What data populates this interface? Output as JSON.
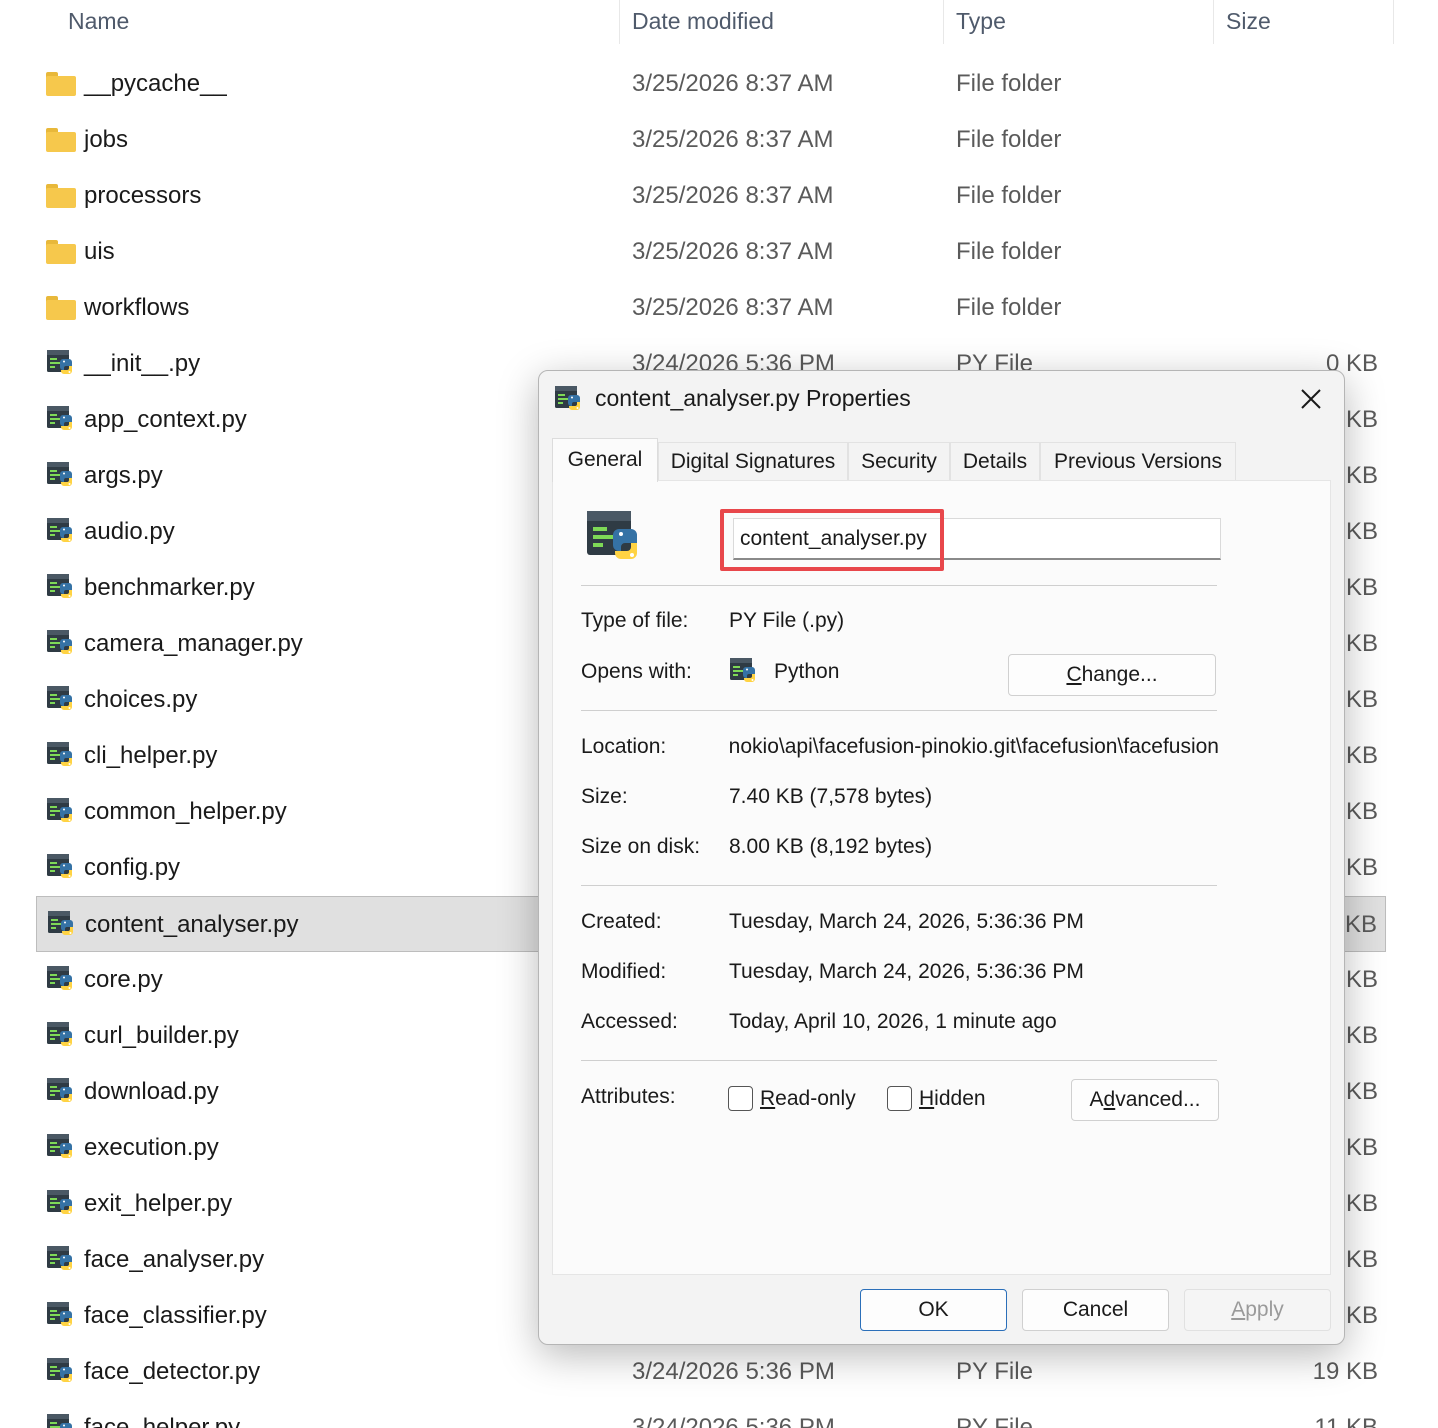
{
  "explorer": {
    "columns": {
      "name": "Name",
      "date": "Date modified",
      "type": "Type",
      "size": "Size"
    },
    "rows": [
      {
        "name": "__pycache__",
        "date": "3/25/2026 8:37 AM",
        "type": "File folder",
        "size": "",
        "icon": "folder-icon"
      },
      {
        "name": "jobs",
        "date": "3/25/2026 8:37 AM",
        "type": "File folder",
        "size": "",
        "icon": "folder-icon"
      },
      {
        "name": "processors",
        "date": "3/25/2026 8:37 AM",
        "type": "File folder",
        "size": "",
        "icon": "folder-icon"
      },
      {
        "name": "uis",
        "date": "3/25/2026 8:37 AM",
        "type": "File folder",
        "size": "",
        "icon": "folder-icon"
      },
      {
        "name": "workflows",
        "date": "3/25/2026 8:37 AM",
        "type": "File folder",
        "size": "",
        "icon": "folder-icon"
      },
      {
        "name": "__init__.py",
        "date": "3/24/2026 5:36 PM",
        "type": "PY File",
        "size": "0 KB",
        "icon": "python-file-icon"
      },
      {
        "name": "app_context.py",
        "date": "",
        "type": "",
        "size": "KB",
        "icon": "python-file-icon"
      },
      {
        "name": "args.py",
        "date": "",
        "type": "",
        "size": "KB",
        "icon": "python-file-icon"
      },
      {
        "name": "audio.py",
        "date": "",
        "type": "",
        "size": "KB",
        "icon": "python-file-icon"
      },
      {
        "name": "benchmarker.py",
        "date": "",
        "type": "",
        "size": "KB",
        "icon": "python-file-icon"
      },
      {
        "name": "camera_manager.py",
        "date": "",
        "type": "",
        "size": "KB",
        "icon": "python-file-icon"
      },
      {
        "name": "choices.py",
        "date": "",
        "type": "",
        "size": "KB",
        "icon": "python-file-icon"
      },
      {
        "name": "cli_helper.py",
        "date": "",
        "type": "",
        "size": "KB",
        "icon": "python-file-icon"
      },
      {
        "name": "common_helper.py",
        "date": "",
        "type": "",
        "size": "KB",
        "icon": "python-file-icon"
      },
      {
        "name": "config.py",
        "date": "",
        "type": "",
        "size": "KB",
        "icon": "python-file-icon"
      },
      {
        "name": "content_analyser.py",
        "date": "",
        "type": "",
        "size": "KB",
        "icon": "python-file-icon",
        "selected": true
      },
      {
        "name": "core.py",
        "date": "",
        "type": "",
        "size": "KB",
        "icon": "python-file-icon"
      },
      {
        "name": "curl_builder.py",
        "date": "",
        "type": "",
        "size": "KB",
        "icon": "python-file-icon"
      },
      {
        "name": "download.py",
        "date": "",
        "type": "",
        "size": "KB",
        "icon": "python-file-icon"
      },
      {
        "name": "execution.py",
        "date": "",
        "type": "",
        "size": "KB",
        "icon": "python-file-icon"
      },
      {
        "name": "exit_helper.py",
        "date": "",
        "type": "",
        "size": "KB",
        "icon": "python-file-icon"
      },
      {
        "name": "face_analyser.py",
        "date": "",
        "type": "",
        "size": "KB",
        "icon": "python-file-icon"
      },
      {
        "name": "face_classifier.py",
        "date": "",
        "type": "",
        "size": "KB",
        "icon": "python-file-icon"
      },
      {
        "name": "face_detector.py",
        "date": "3/24/2026 5:36 PM",
        "type": "PY File",
        "size": "19 KB",
        "icon": "python-file-icon"
      },
      {
        "name": "face_helper.py",
        "date": "3/24/2026 5:36 PM",
        "type": "PY File",
        "size": "11 KB",
        "icon": "python-file-icon"
      }
    ]
  },
  "dialog": {
    "title": "content_analyser.py Properties",
    "tabs": [
      "General",
      "Digital Signatures",
      "Security",
      "Details",
      "Previous Versions"
    ],
    "active_tab": "General",
    "filename": "content_analyser.py",
    "type_label": "Type of file:",
    "type_value": "PY File (.py)",
    "opens_label": "Opens with:",
    "opens_value": "Python",
    "change_button": {
      "pre": "",
      "u": "C",
      "post": "hange..."
    },
    "location_label": "Location:",
    "location_value": "C:\\pinokio\\api\\facefusion-pinokio.git\\facefusion\\facefusion",
    "size_label": "Size:",
    "size_value": "7.40 KB (7,578 bytes)",
    "size_disk_label": "Size on disk:",
    "size_disk_value": "8.00 KB (8,192 bytes)",
    "created_label": "Created:",
    "created_value": "Tuesday, March 24, 2026, 5:36:36 PM",
    "modified_label": "Modified:",
    "modified_value": "Tuesday, March 24, 2026, 5:36:36 PM",
    "accessed_label": "Accessed:",
    "accessed_value": "Today, April 10, 2026, 1 minute ago",
    "attributes_label": "Attributes:",
    "readonly": {
      "u": "R",
      "rest": "ead-only"
    },
    "hidden": {
      "u": "H",
      "rest": "idden"
    },
    "advanced_button": {
      "pre": "A",
      "u": "d",
      "post": "vanced..."
    },
    "ok_label": "OK",
    "cancel_label": "Cancel",
    "apply_button": {
      "u": "A",
      "post": "pply"
    }
  },
  "colors": {
    "highlight": "#e8474b",
    "primary_border": "#2b6fb9",
    "folder": "#f6c84c",
    "python_blue": "#3572a5",
    "python_yellow": "#ffd343"
  }
}
